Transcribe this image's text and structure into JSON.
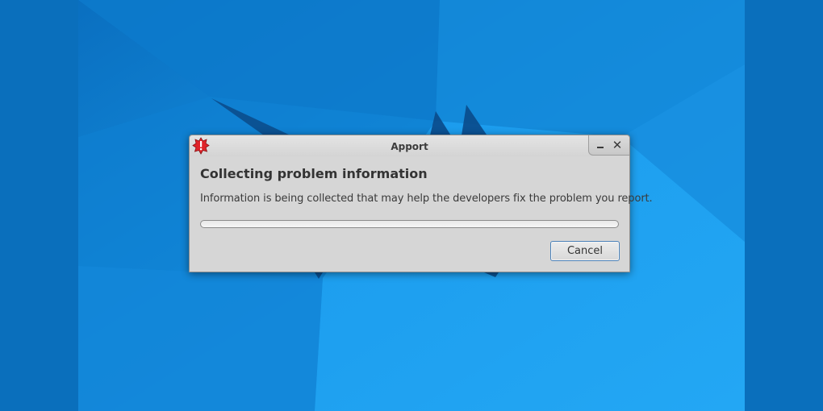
{
  "window": {
    "title": "Apport",
    "app_icon": "apport-crash-icon",
    "minimize_icon": "minimize-icon",
    "close_icon": "close-icon",
    "close_glyph": "✕"
  },
  "dialog": {
    "heading": "Collecting problem information",
    "message": "Information is being collected that may help the developers fix the problem you report.",
    "progress_fraction": 0,
    "cancel_label": "Cancel"
  },
  "colors": {
    "desktop_blue": "#0f86d8",
    "dialog_bg": "#d6d6d6",
    "button_focus_border": "#4d82b8",
    "icon_red": "#e0242a"
  }
}
